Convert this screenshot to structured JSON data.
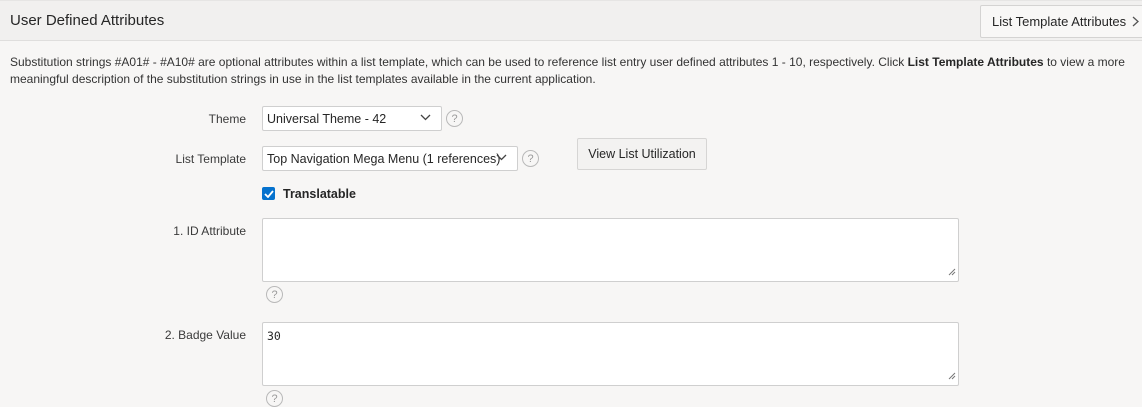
{
  "region": {
    "title": "User Defined Attributes",
    "header_button": "List Template Attributes"
  },
  "description": {
    "part1": "Substitution strings #A01# - #A10# are optional attributes within a list template, which can be used to reference list entry user defined attributes 1 - 10, respectively. Click ",
    "bold": "List Template Attributes",
    "part2": " to view a more meaningful description of the substitution strings in use in the list templates available in the current application."
  },
  "form": {
    "theme": {
      "label": "Theme",
      "value": "Universal Theme - 42"
    },
    "list_template": {
      "label": "List Template",
      "value": "Top Navigation Mega Menu (1 references)"
    },
    "view_list_button": "View List Utilization",
    "translatable": {
      "label": "Translatable",
      "checked": true
    },
    "attr1": {
      "label": "1. ID Attribute",
      "value": ""
    },
    "attr2": {
      "label": "2. Badge Value",
      "value": "30"
    },
    "help_glyph": "?"
  },
  "icons": {
    "chevron_right": "chevron-right-icon",
    "chevron_down": "chevron-down-icon",
    "help": "help-icon",
    "check": "check-icon",
    "resize": "resize-grip-icon"
  },
  "colors": {
    "accent": "#0572ce",
    "header_bg": "#f1f0ef",
    "page_bg": "#f7f6f5"
  }
}
